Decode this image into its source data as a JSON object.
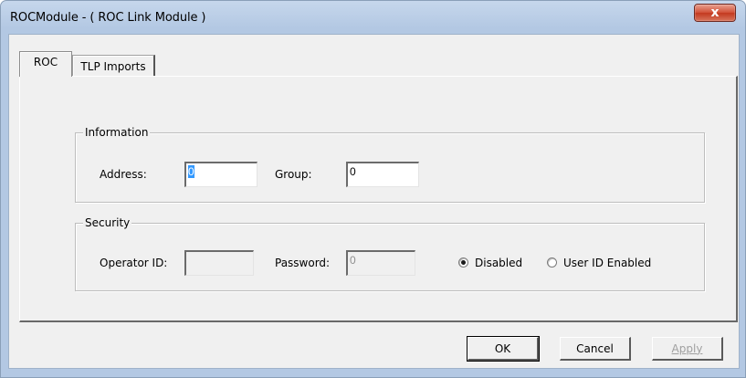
{
  "window": {
    "title": "ROCModule - ( ROC Link Module )",
    "close_glyph": "x"
  },
  "tabs": [
    {
      "label": "ROC",
      "selected": true
    },
    {
      "label": "TLP Imports",
      "selected": false
    }
  ],
  "information": {
    "legend": "Information",
    "address_label": "Address:",
    "address_value": "0",
    "group_label": "Group:",
    "group_value": "0"
  },
  "security": {
    "legend": "Security",
    "operator_label": "Operator ID:",
    "operator_value": "",
    "password_label": "Password:",
    "password_value": "0",
    "radio_disabled_label": "Disabled",
    "radio_disabled_checked": true,
    "radio_userid_label": "User ID Enabled",
    "radio_userid_checked": false
  },
  "buttons": {
    "ok": "OK",
    "cancel": "Cancel",
    "apply": "Apply"
  },
  "colors": {
    "frame": "#b3c8e3",
    "close": "#c3391f",
    "selection": "#3399ff",
    "face": "#f0f0f0"
  }
}
